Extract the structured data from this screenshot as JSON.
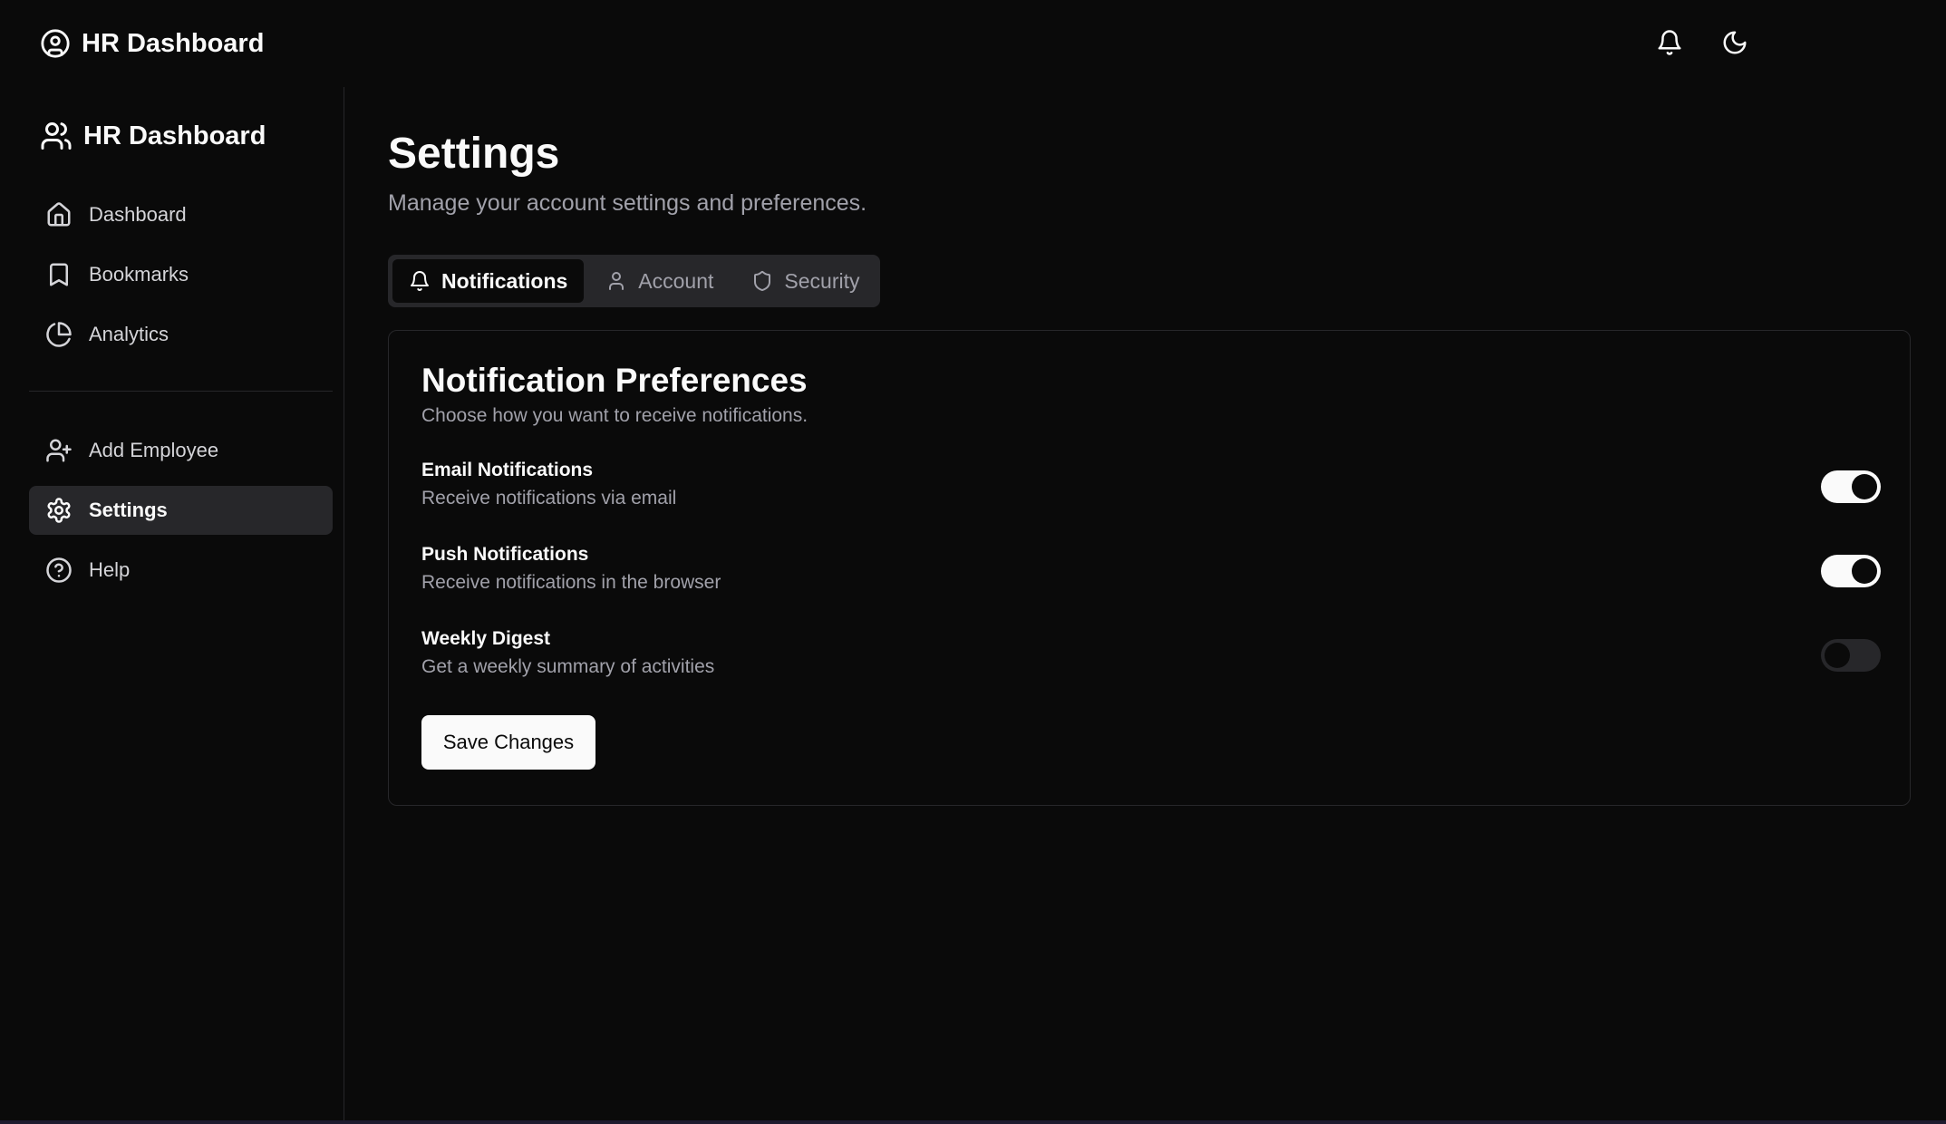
{
  "topbar": {
    "title": "HR Dashboard",
    "icons": [
      "user-circle-icon",
      "bell-icon",
      "moon-icon"
    ]
  },
  "sidebar": {
    "title": "HR Dashboard",
    "items_primary": [
      {
        "label": "Dashboard",
        "icon": "home-icon"
      },
      {
        "label": "Bookmarks",
        "icon": "bookmark-icon"
      },
      {
        "label": "Analytics",
        "icon": "pie-chart-icon"
      }
    ],
    "items_secondary": [
      {
        "label": "Add Employee",
        "icon": "user-plus-icon"
      },
      {
        "label": "Settings",
        "icon": "gear-icon",
        "active": true
      },
      {
        "label": "Help",
        "icon": "help-circle-icon"
      }
    ]
  },
  "main": {
    "title": "Settings",
    "subtitle": "Manage your account settings and preferences.",
    "tabs": [
      {
        "label": "Notifications",
        "icon": "bell-icon",
        "active": true
      },
      {
        "label": "Account",
        "icon": "user-icon"
      },
      {
        "label": "Security",
        "icon": "shield-icon"
      }
    ],
    "card": {
      "title": "Notification Preferences",
      "subtitle": "Choose how you want to receive notifications.",
      "preferences": [
        {
          "label": "Email Notifications",
          "description": "Receive notifications via email",
          "enabled": true
        },
        {
          "label": "Push Notifications",
          "description": "Receive notifications in the browser",
          "enabled": true
        },
        {
          "label": "Weekly Digest",
          "description": "Get a weekly summary of activities",
          "enabled": false
        }
      ],
      "save_label": "Save Changes"
    }
  },
  "colors": {
    "background": "#0a0a0a",
    "foreground": "#fafafa",
    "muted": "#a1a1aa",
    "border": "#27272a"
  }
}
